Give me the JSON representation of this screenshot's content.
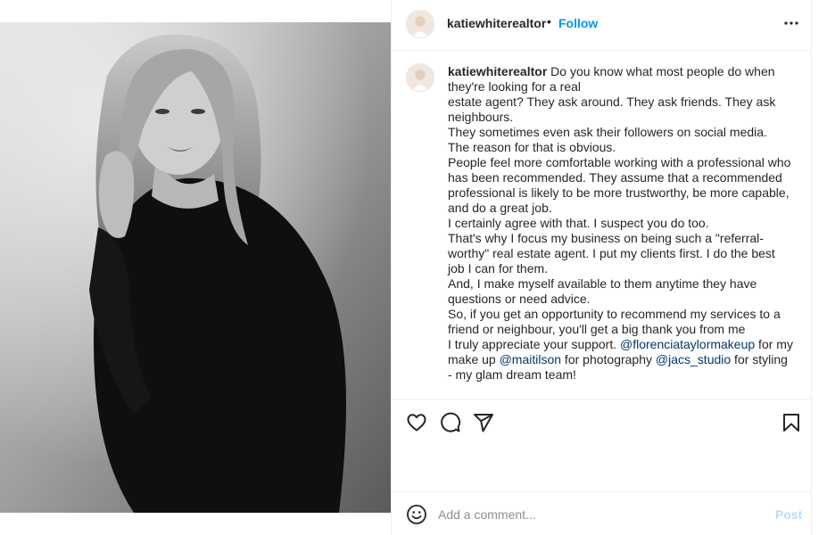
{
  "post": {
    "username": "katiewhiterealtor",
    "header_separator": "•",
    "follow_label": "Follow",
    "more_icon": "more-horizontal-icon",
    "avatar_icon": "profile-avatar"
  },
  "caption": {
    "username": "katiewhiterealtor",
    "lines": [
      "Do you know what most people do when they're looking for a real",
      "estate agent? They ask around. They ask friends. They ask neighbours.",
      "They sometimes even ask their followers on social media.",
      "The reason for that is obvious.",
      "People feel more comfortable working with a professional who has been recommended. They assume that a recommended professional is likely to be more trustworthy, be more capable, and do a great job.",
      "I certainly agree with that. I suspect you do too.",
      "That's why I focus my business on being such a \"referral-worthy\" real estate agent. I put my clients first. I do the best job I can for them.",
      "And, I make myself available to them anytime they have questions or need advice.",
      "So, if you get an opportunity to recommend my services to a friend or neighbour, you'll get a big thank you from me"
    ],
    "closing": {
      "t1": "I truly appreciate your support. ",
      "m1": "@florenciataylormakeup",
      "t2": " for my make up ",
      "m2": "@maitilson",
      "t3": " for photography ",
      "m3": "@jacs_studio",
      "t4": " for styling - my glam dream team!"
    }
  },
  "actions": {
    "like_icon": "heart-icon",
    "comment_icon": "comment-bubble-icon",
    "share_icon": "paper-plane-icon",
    "save_icon": "bookmark-icon"
  },
  "comment_box": {
    "emoji_icon": "smiley-icon",
    "placeholder": "Add a comment...",
    "value": "",
    "post_label": "Post"
  },
  "colors": {
    "link_blue": "#0095f6",
    "mention_blue": "#00376b",
    "post_disabled": "#b2dffc",
    "text": "#262626",
    "placeholder": "#8e8e8e",
    "divider": "#efefef"
  }
}
